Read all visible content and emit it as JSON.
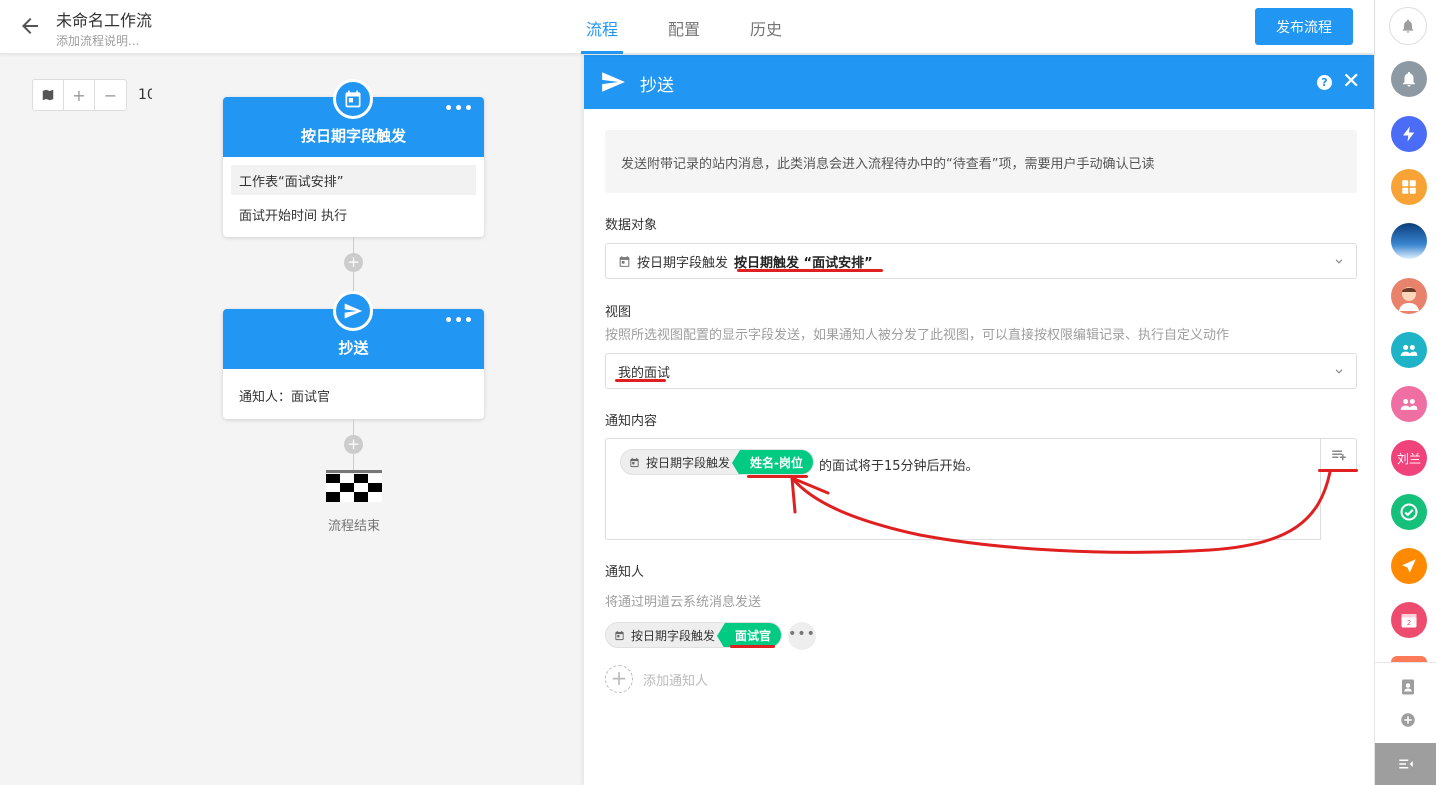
{
  "header": {
    "title": "未命名工作流",
    "description": "添加流程说明...",
    "tabs": [
      {
        "label": "流程"
      },
      {
        "label": "配置"
      },
      {
        "label": "历史"
      }
    ],
    "publish_label": "发布流程"
  },
  "canvas": {
    "zoom_value": "10",
    "trigger_node": {
      "title": "按日期字段触发",
      "row1": "工作表“面试安排”",
      "row2": "面试开始时间 执行",
      "more": "•••"
    },
    "cc_node": {
      "title": "抄送",
      "row1": "通知人：面试官",
      "more": "•••"
    },
    "end_label": "流程结束"
  },
  "panel": {
    "title": "抄送",
    "help": "?",
    "close": "✕",
    "tip": "发送附带记录的站内消息，此类消息会进入流程待办中的“待查看”项，需要用户手动确认已读",
    "data_object": {
      "label": "数据对象",
      "source": "按日期字段触发",
      "value": "按日期触发 “面试安排”"
    },
    "view": {
      "label": "视图",
      "sub": "按照所选视图配置的显示字段发送，如果通知人被分发了此视图，可以直接按权限编辑记录、执行自定义动作",
      "value": "我的面试"
    },
    "content": {
      "label": "通知内容",
      "chip_source": "按日期字段触发",
      "chip_field": "姓名-岗位",
      "text": "的面试将于15分钟后开始。"
    },
    "notifier": {
      "label": "通知人",
      "sub": "将通过明道云系统消息发送",
      "chip_source": "按日期字段触发",
      "chip_field": "面试官",
      "more": "•••",
      "add_label": "添加通知人"
    }
  },
  "sidebar": {
    "apps": [
      {
        "color": "#8d9aa3",
        "icon": "bell-icon"
      },
      {
        "color": "#4a6cf7",
        "icon": "sparkle-icon"
      },
      {
        "color": "#f7a335",
        "icon": "grid-icon"
      },
      {
        "color": "#1e5fa8",
        "icon": "landscape-icon"
      },
      {
        "color": "#e8826b",
        "icon": "avatar-icon"
      },
      {
        "color": "#1fb3c7",
        "icon": "group-icon"
      },
      {
        "color": "#ef6fa2",
        "icon": "group-icon"
      },
      {
        "color": "#f0437b",
        "icon": "user-text",
        "text": "刘兰"
      },
      {
        "color": "#14c07a",
        "icon": "check-icon"
      },
      {
        "color": "#ff8a00",
        "icon": "send-icon"
      },
      {
        "color": "#ee4c6e",
        "icon": "calendar-icon",
        "text": "2"
      }
    ]
  },
  "colors": {
    "primary": "#2196f3",
    "field_green": "#01ca83",
    "annotation_red": "#e02020"
  }
}
